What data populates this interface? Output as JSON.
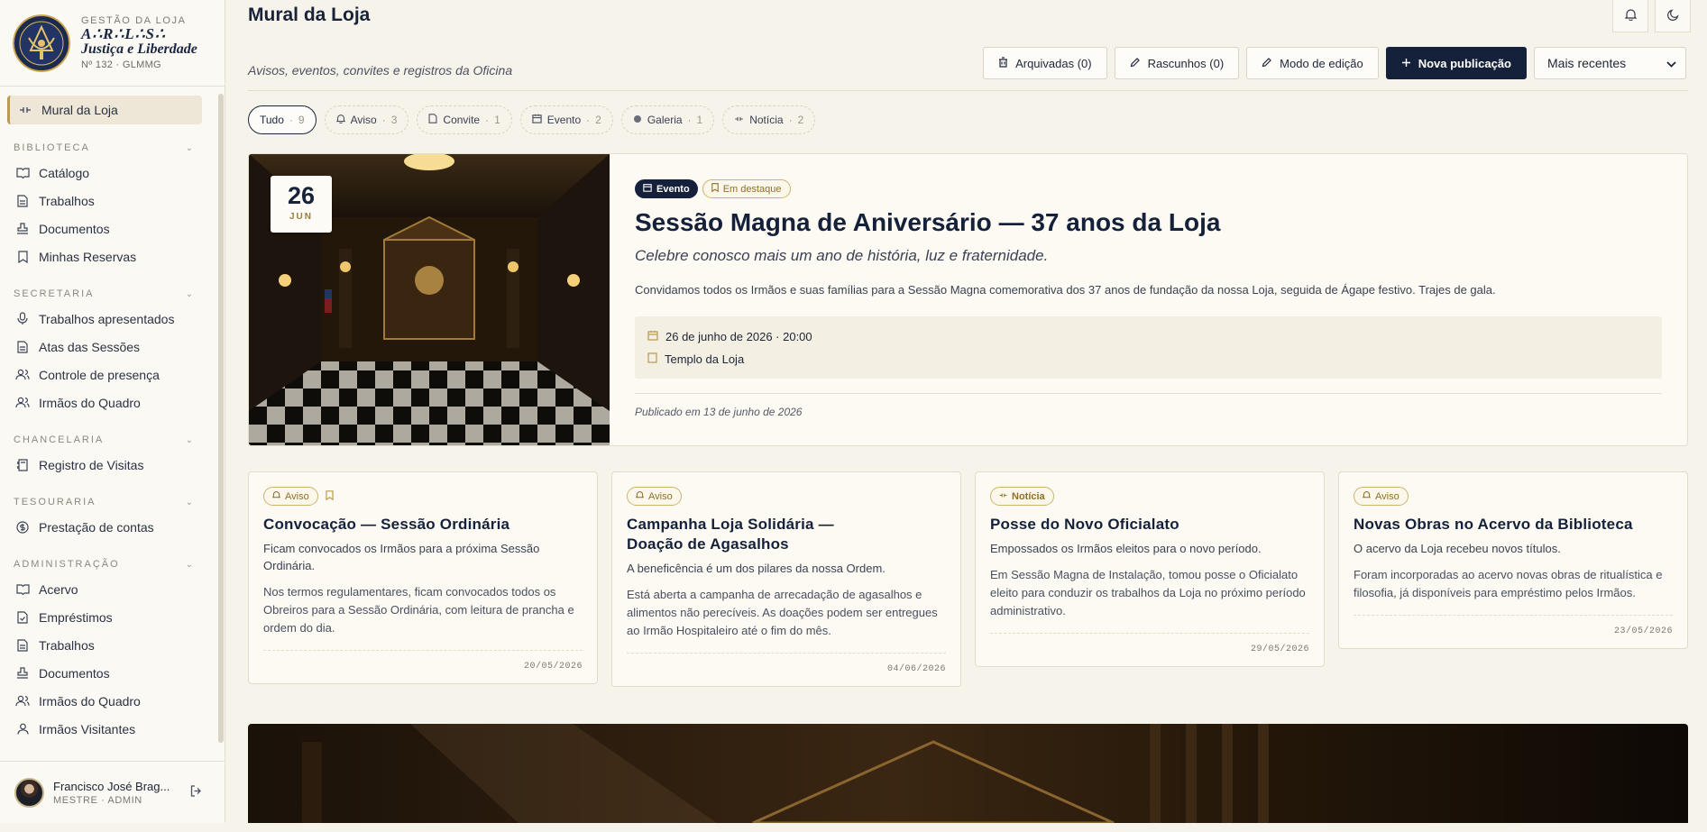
{
  "brand": {
    "kicker": "GESTÃO DA LOJA",
    "name_line1": "A∴R∴L∴S∴",
    "name_line2": "Justiça e Liberdade",
    "sub": "Nº 132 · GLMMG"
  },
  "nav": {
    "active": "Mural da Loja",
    "groups": [
      {
        "label": "BIBLIOTECA",
        "items": [
          "Catálogo",
          "Trabalhos",
          "Documentos",
          "Minhas Reservas"
        ]
      },
      {
        "label": "SECRETARIA",
        "items": [
          "Trabalhos apresentados",
          "Atas das Sessões",
          "Controle de presença",
          "Irmãos do Quadro"
        ]
      },
      {
        "label": "CHANCELARIA",
        "items": [
          "Registro de Visitas"
        ]
      },
      {
        "label": "TESOURARIA",
        "items": [
          "Prestação de contas"
        ]
      },
      {
        "label": "ADMINISTRAÇÃO",
        "items": [
          "Acervo",
          "Empréstimos",
          "Trabalhos",
          "Documentos",
          "Irmãos do Quadro",
          "Irmãos Visitantes"
        ]
      }
    ]
  },
  "user": {
    "name": "Francisco José Brag...",
    "role": "MESTRE · ADMIN"
  },
  "header": {
    "title": "Mural da Loja",
    "subtitle": "Avisos, eventos, convites e registros da Oficina"
  },
  "actions": {
    "archived": "Arquivadas (0)",
    "drafts": "Rascunhos (0)",
    "edit_mode": "Modo de edição",
    "new_post": "Nova publicação",
    "sort": "Mais recentes"
  },
  "filters": [
    {
      "label": "Tudo",
      "count": "9"
    },
    {
      "label": "Aviso",
      "count": "3"
    },
    {
      "label": "Convite",
      "count": "1"
    },
    {
      "label": "Evento",
      "count": "2"
    },
    {
      "label": "Galeria",
      "count": "1"
    },
    {
      "label": "Notícia",
      "count": "2"
    }
  ],
  "featured": {
    "day": "26",
    "month": "JUN",
    "type": "Evento",
    "highlight": "Em destaque",
    "title": "Sessão Magna de Aniversário — 37 anos da Loja",
    "lead": "Celebre conosco mais um ano de história, luz e fraternidade.",
    "description": "Convidamos todos os Irmãos e suas famílias para a Sessão Magna comemorativa dos 37 anos de fundação da nossa Loja, seguida de Ágape festivo. Trajes de gala.",
    "when": "26 de junho de 2026 · 20:00",
    "where": "Templo da Loja",
    "published": "Publicado em 13 de junho de 2026"
  },
  "cards": [
    {
      "type": "Aviso",
      "title": "Convocação — Sessão Ordinária",
      "lead": "Ficam convocados os Irmãos para a próxima Sessão Ordinária.",
      "body": "Nos termos regulamentares, ficam convocados todos os Obreiros para a Sessão Ordinária, com leitura de prancha e ordem do dia.",
      "date": "20/05/2026"
    },
    {
      "type": "Aviso",
      "title": "Campanha Loja Solidária — Doação de Agasalhos",
      "lead": "A beneficência é um dos pilares da nossa Ordem.",
      "body": "Está aberta a campanha de arrecadação de agasalhos e alimentos não perecíveis. As doações podem ser entregues ao Irmão Hospitaleiro até o fim do mês.",
      "date": "04/06/2026"
    },
    {
      "type": "Notícia",
      "title": "Posse do Novo Oficialato",
      "lead": "Empossados os Irmãos eleitos para o novo período.",
      "body": "Em Sessão Magna de Instalação, tomou posse o Oficialato eleito para conduzir os trabalhos da Loja no próximo período administrativo.",
      "date": "29/05/2026"
    },
    {
      "type": "Aviso",
      "title": "Novas Obras no Acervo da Biblioteca",
      "lead": "O acervo da Loja recebeu novos títulos.",
      "body": "Foram incorporadas ao acervo novas obras de ritualística e filosofia, já disponíveis para empréstimo pelos Irmãos.",
      "date": "23/05/2026"
    }
  ]
}
